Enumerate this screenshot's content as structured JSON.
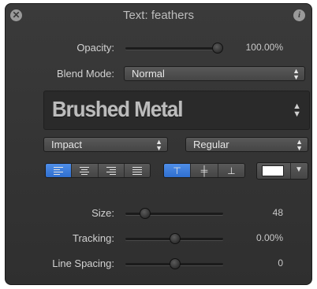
{
  "window": {
    "title": "Text: feathers",
    "close_glyph": "✕",
    "info_glyph": "i"
  },
  "opacity": {
    "label": "Opacity:",
    "value_text": "100.00%",
    "value": 1.0
  },
  "blend_mode": {
    "label": "Blend Mode:",
    "selected": "Normal"
  },
  "preview": {
    "sample_text": "Brushed Metal",
    "style": "Brushed Metal"
  },
  "font": {
    "family": "Impact",
    "typeface": "Regular"
  },
  "alignment": {
    "horizontal": [
      "left",
      "center",
      "right",
      "justify"
    ],
    "horizontal_selected": "left",
    "vertical": [
      "top",
      "middle",
      "bottom"
    ],
    "vertical_selected": "top",
    "vertical_glyphs": [
      "⊤",
      "╪",
      "⊥"
    ]
  },
  "face_color": {
    "color": "#ffffff",
    "dropdown_glyph": "▼"
  },
  "size": {
    "label": "Size:",
    "value_text": "48",
    "slider_fraction": 0.15
  },
  "tracking": {
    "label": "Tracking:",
    "value_text": "0.00%",
    "slider_fraction": 0.5
  },
  "line_spacing": {
    "label": "Line Spacing:",
    "value_text": "0",
    "slider_fraction": 0.5
  },
  "colors": {
    "accent": "#3a7ddb",
    "panel": "#353535"
  }
}
